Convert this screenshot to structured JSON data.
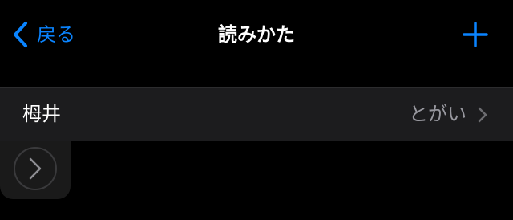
{
  "navbar": {
    "back_label": "戻る",
    "title": "読みかた",
    "add_icon": "plus-icon"
  },
  "list": {
    "rows": [
      {
        "title": "栂井",
        "value": "とがい",
        "icon": "chevron-right-icon"
      }
    ]
  },
  "overlay": {
    "icon": "assistive-touch-chevron-icon"
  },
  "colors": {
    "background": "#000000",
    "accent": "#0a84ff",
    "row_background": "#1c1c1e",
    "secondary_text": "#98989f",
    "chevron": "#6c6c70"
  }
}
